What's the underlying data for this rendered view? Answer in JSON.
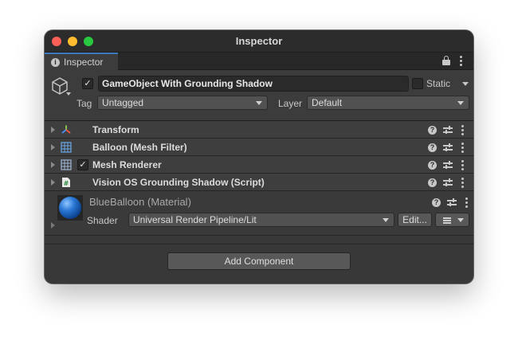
{
  "window": {
    "title": "Inspector"
  },
  "tab": {
    "label": "Inspector",
    "icon": "info-icon"
  },
  "gameobject": {
    "active": true,
    "name": "GameObject With Grounding Shadow",
    "static_label": "Static",
    "static_checked": false,
    "tag_label": "Tag",
    "tag_value": "Untagged",
    "layer_label": "Layer",
    "layer_value": "Default"
  },
  "components": [
    {
      "title": "Transform",
      "icon": "transform-icon",
      "has_toggle": false
    },
    {
      "title": "Balloon (Mesh Filter)",
      "icon": "mesh-filter-icon",
      "has_toggle": false
    },
    {
      "title": "Mesh Renderer",
      "icon": "mesh-renderer-icon",
      "has_toggle": true,
      "enabled": true
    },
    {
      "title": "Vision OS Grounding Shadow (Script)",
      "icon": "script-icon",
      "has_toggle": false
    }
  ],
  "material": {
    "name": "BlueBalloon (Material)",
    "shader_label": "Shader",
    "shader_value": "Universal Render Pipeline/Lit",
    "edit_label": "Edit..."
  },
  "add_component_label": "Add Component",
  "colors": {
    "accent": "#3a79bb",
    "panel": "#383838",
    "header": "#3c3c3c"
  }
}
